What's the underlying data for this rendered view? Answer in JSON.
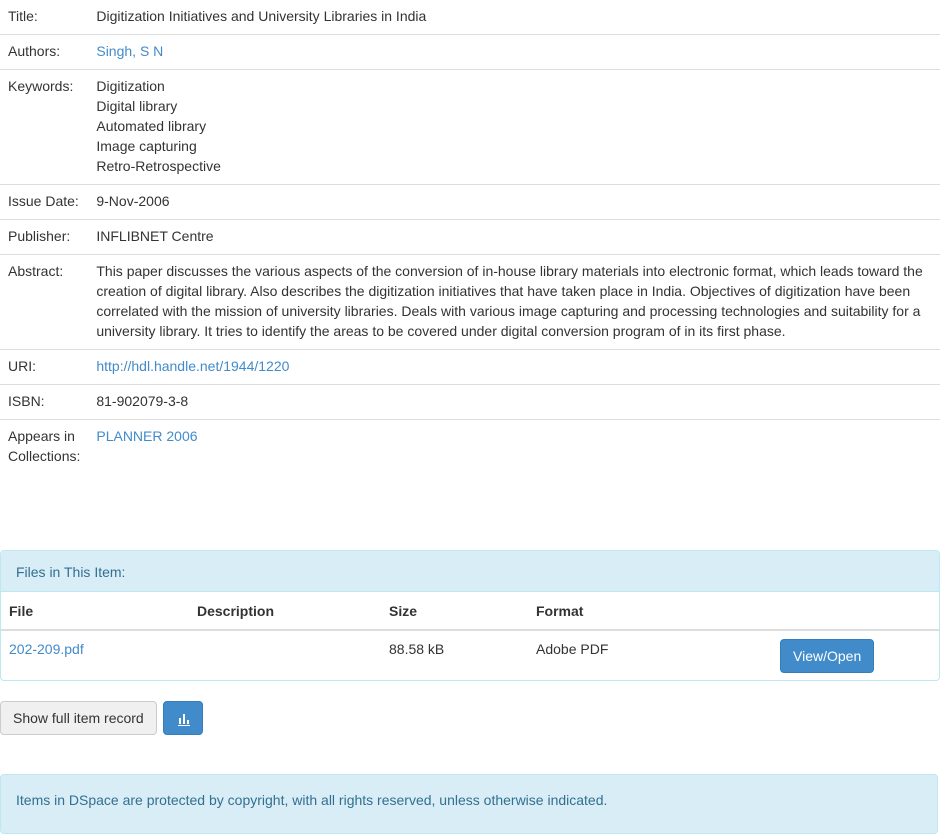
{
  "metadata": {
    "title_label": "Title:",
    "title_value": "Digitization Initiatives and University Libraries in India",
    "authors_label": "Authors:",
    "authors_value": "Singh, S N",
    "keywords_label": "Keywords:",
    "keywords": [
      "Digitization",
      "Digital library",
      "Automated library",
      "Image capturing",
      "Retro-Retrospective"
    ],
    "issue_date_label": "Issue Date:",
    "issue_date_value": "9-Nov-2006",
    "publisher_label": "Publisher:",
    "publisher_value": "INFLIBNET Centre",
    "abstract_label": "Abstract:",
    "abstract_value": "This paper discusses the various aspects of the conversion of in-house library materials into electronic format, which leads toward the creation of digital library. Also describes the digitization initiatives that have taken place in India. Objectives of digitization have been correlated with the mission of university libraries. Deals with various image capturing and processing technologies and suitability for a university library. It tries to identify the areas to be covered under digital conversion program of in its first phase.",
    "uri_label": "URI:",
    "uri_value": "http://hdl.handle.net/1944/1220",
    "isbn_label": "ISBN:",
    "isbn_value": "81-902079-3-8",
    "collections_label": "Appears in Collections:",
    "collections_value": "PLANNER 2006"
  },
  "files": {
    "heading": "Files in This Item:",
    "columns": {
      "file": "File",
      "description": "Description",
      "size": "Size",
      "format": "Format"
    },
    "rows": [
      {
        "file": "202-209.pdf",
        "description": "",
        "size": "88.58 kB",
        "format": "Adobe PDF",
        "action": "View/Open"
      }
    ]
  },
  "actions": {
    "show_full_record": "Show full item record",
    "stats_icon": "bar-chart-icon"
  },
  "footer": {
    "copyright": "Items in DSpace are protected by copyright, with all rights reserved, unless otherwise indicated."
  },
  "colors": {
    "link": "#428bca",
    "primary_button": "#428bca",
    "info_background": "#d9edf7",
    "info_text": "#31708f"
  }
}
